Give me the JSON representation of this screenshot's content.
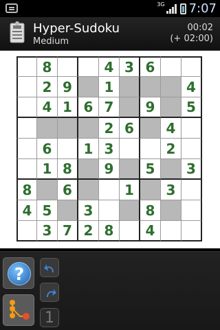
{
  "status": {
    "network": "3G",
    "time": "7:07"
  },
  "header": {
    "title": "Hyper-Sudoku",
    "difficulty": "Medium",
    "timer": "00:02",
    "penalty": "(+ 02:00)"
  },
  "board": {
    "values": [
      [
        "",
        "8",
        "",
        "",
        "4",
        "3",
        "6",
        "",
        ""
      ],
      [
        "",
        "2",
        "9",
        "",
        "1",
        "",
        "",
        "",
        "4"
      ],
      [
        "",
        "4",
        "1",
        "6",
        "7",
        "",
        "9",
        "",
        "5"
      ],
      [
        "",
        "",
        "",
        "",
        "2",
        "6",
        "",
        "4",
        ""
      ],
      [
        "",
        "6",
        "",
        "1",
        "3",
        "",
        "",
        "2",
        ""
      ],
      [
        "",
        "1",
        "8",
        "",
        "9",
        "",
        "5",
        "",
        "3"
      ],
      [
        "8",
        "",
        "6",
        "",
        "",
        "1",
        "",
        "3",
        ""
      ],
      [
        "4",
        "5",
        "",
        "3",
        "",
        "",
        "8",
        "",
        ""
      ],
      [
        "",
        "3",
        "7",
        "2",
        "8",
        "",
        "4",
        "",
        ""
      ]
    ],
    "shaded": [
      [
        0,
        0,
        0,
        0,
        0,
        0,
        0,
        0,
        0
      ],
      [
        0,
        0,
        0,
        1,
        0,
        1,
        1,
        1,
        0
      ],
      [
        0,
        0,
        0,
        0,
        0,
        1,
        0,
        1,
        0
      ],
      [
        0,
        1,
        1,
        1,
        0,
        0,
        1,
        0,
        0
      ],
      [
        0,
        0,
        0,
        0,
        0,
        0,
        0,
        0,
        0
      ],
      [
        0,
        0,
        0,
        1,
        0,
        1,
        0,
        1,
        0
      ],
      [
        0,
        1,
        0,
        1,
        0,
        0,
        1,
        0,
        0
      ],
      [
        0,
        0,
        1,
        0,
        0,
        1,
        0,
        1,
        0
      ],
      [
        0,
        0,
        0,
        0,
        0,
        0,
        0,
        0,
        0
      ]
    ]
  },
  "toolbar": {
    "help_symbol": "?",
    "number_symbol": "1"
  },
  "colors": {
    "digit": "#2e6e2e",
    "shade": "#b8b8b8",
    "help_blue": "#1f5faa",
    "undo_blue": "#3d82d1",
    "tree_orange": "#f39c12",
    "tree_red": "#e84e2b"
  }
}
